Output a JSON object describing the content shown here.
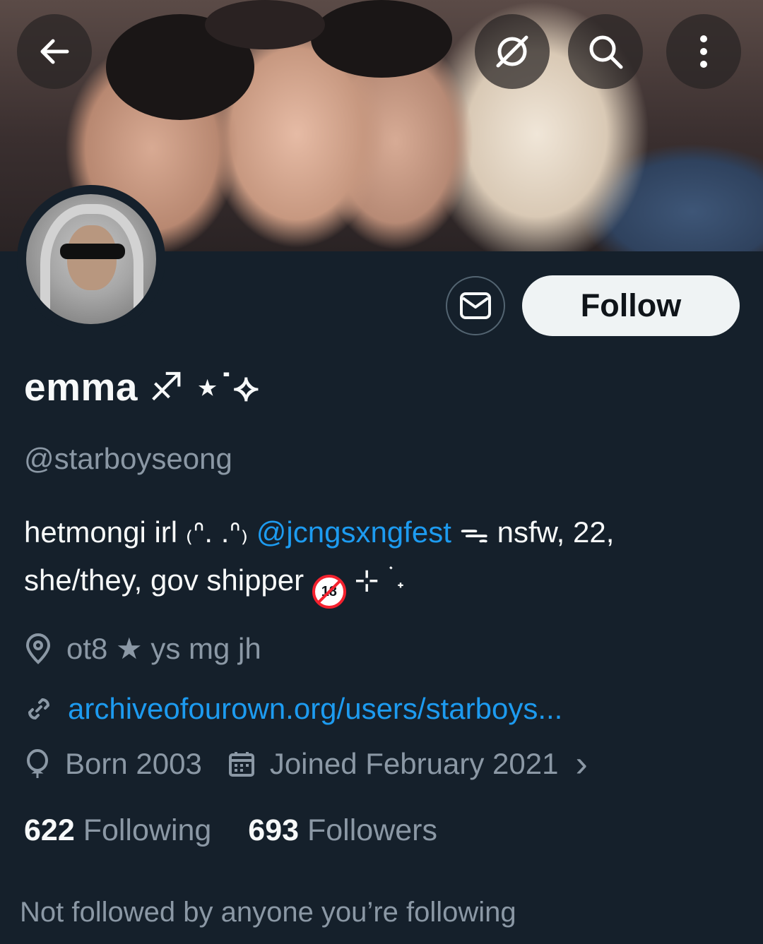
{
  "header": {
    "back_icon": "arrow-left-icon",
    "grok_icon": "grok-icon",
    "search_icon": "search-icon",
    "more_icon": "more-vertical-icon"
  },
  "actions": {
    "message_icon": "envelope-icon",
    "follow_label": "Follow"
  },
  "profile": {
    "display_name": "emma ♐︎ ⋆˙⟡",
    "handle": "@starboyseong",
    "bio": {
      "part1": "hetmongi irl ₍ᐢ. .ᐢ₎ ",
      "mention": "@jcngsxngfest",
      "part2": " ᯓ nsfw, 22, she/they, gov shipper ",
      "badge_text": "18",
      "part3": " ⊹ ࣪ ˖"
    },
    "location": "ot8 ★ ys mg jh",
    "website": "archiveofourown.org/users/starboys...",
    "born": "Born 2003",
    "joined": "Joined February 2021",
    "joined_chevron": "›"
  },
  "stats": {
    "following_count": "622",
    "following_label": "Following",
    "followers_count": "693",
    "followers_label": "Followers"
  },
  "footer_note": "Not followed by anyone you’re following",
  "colors": {
    "background": "#15202b",
    "text": "#f7f9f9",
    "muted": "#8b98a5",
    "accent": "#1d9bf0",
    "follow_bg": "#eff3f4"
  }
}
